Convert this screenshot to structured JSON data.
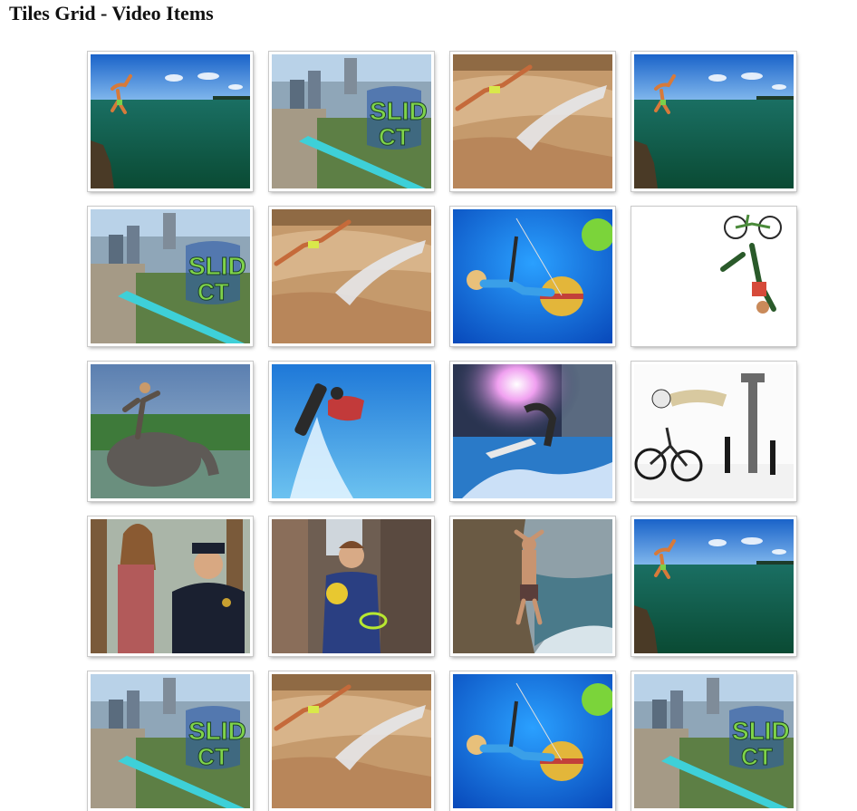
{
  "page": {
    "title": "Tiles Grid - Video Items"
  },
  "tiles": [
    {
      "label": "Cliff dive into ocean",
      "scene": "ocean-dive"
    },
    {
      "label": "Slide the City",
      "scene": "slide-city"
    },
    {
      "label": "Rock slide",
      "scene": "rock-slide"
    },
    {
      "label": "Cliff dive into ocean",
      "scene": "ocean-dive"
    },
    {
      "label": "Slide the City",
      "scene": "slide-city"
    },
    {
      "label": "Rock slide",
      "scene": "rock-slide"
    },
    {
      "label": "Balloon swing",
      "scene": "balloon"
    },
    {
      "label": "BMX backflip",
      "scene": "bmx-white"
    },
    {
      "label": "Elephant surfing",
      "scene": "elephant"
    },
    {
      "label": "Flyboard",
      "scene": "flyboard"
    },
    {
      "label": "Wakeboard spray",
      "scene": "wakeboard"
    },
    {
      "label": "BMX street",
      "scene": "bmx-street"
    },
    {
      "label": "Police prank",
      "scene": "police"
    },
    {
      "label": "Alley kid",
      "scene": "alley"
    },
    {
      "label": "Cliff jumper",
      "scene": "cliff-jump"
    },
    {
      "label": "Cliff dive into ocean",
      "scene": "ocean-dive"
    },
    {
      "label": "Slide the City",
      "scene": "slide-city"
    },
    {
      "label": "Rock slide",
      "scene": "rock-slide"
    },
    {
      "label": "Balloon swing",
      "scene": "balloon"
    },
    {
      "label": "Slide the City",
      "scene": "slide-city"
    }
  ],
  "colors": {
    "tile_border": "#ffffff",
    "tile_outline": "#c9c9c9"
  }
}
